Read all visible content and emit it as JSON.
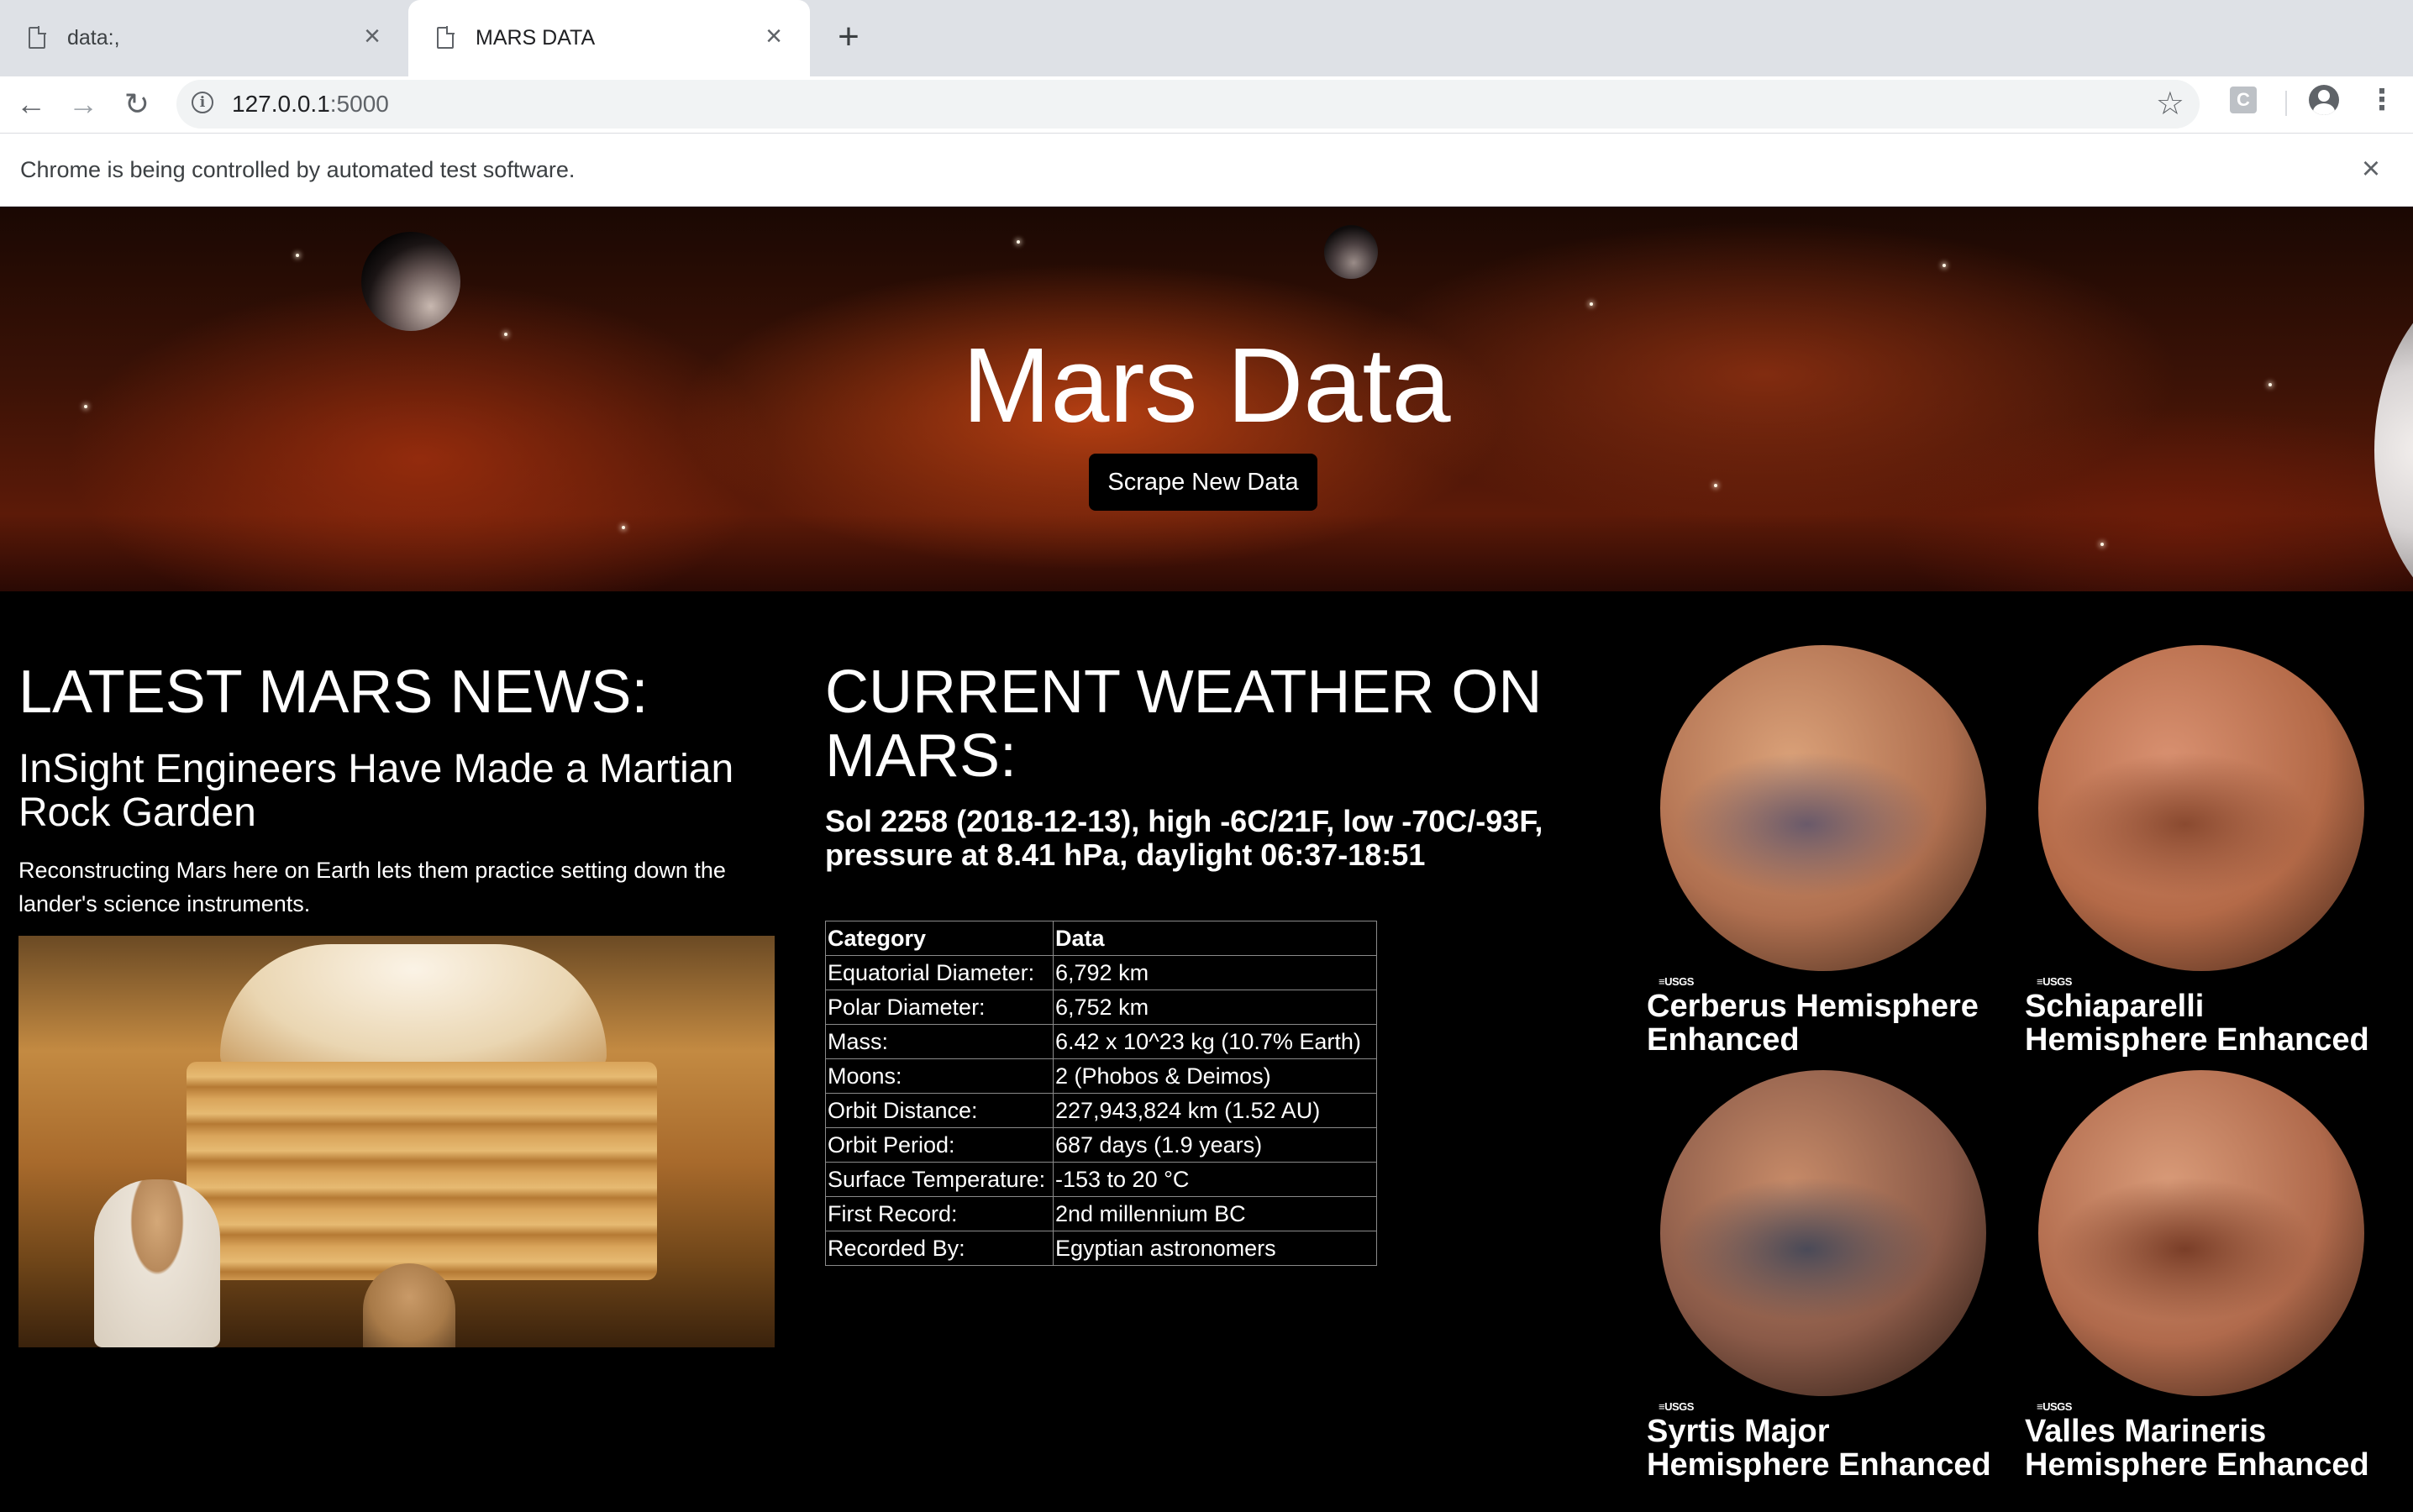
{
  "browser": {
    "tabs": [
      {
        "label": "data:,"
      },
      {
        "label": "MARS DATA"
      }
    ],
    "url_host": "127.0.0.1",
    "url_port": ":5000",
    "infobar_text": "Chrome is being controlled by automated test software.",
    "icons": {
      "back": "back-arrow-icon",
      "forward": "forward-arrow-icon",
      "reload": "reload-icon",
      "site_info": "info-icon",
      "bookmark": "star-icon",
      "extension": "extension-icon",
      "extension_letter": "C",
      "profile": "profile-icon",
      "menu": "kebab-menu-icon"
    }
  },
  "page": {
    "title": "Mars Data",
    "scrape_button": "Scrape New Data",
    "news": {
      "heading": "LATEST MARS NEWS:",
      "title": "InSight Engineers Have Made a Martian Rock Garden",
      "body": "Reconstructing Mars here on Earth lets them practice setting down the lander's science instruments."
    },
    "weather": {
      "heading": "CURRENT WEATHER ON MARS:",
      "text": "Sol 2258 (2018-12-13), high -6C/21F, low -70C/-93F, pressure at 8.41 hPa, daylight 06:37-18:51"
    },
    "facts": {
      "headers": [
        "Category",
        "Data"
      ],
      "rows": [
        [
          "Equatorial Diameter:",
          "6,792 km"
        ],
        [
          "Polar Diameter:",
          "6,752 km"
        ],
        [
          "Mass:",
          "6.42 x 10^23 kg (10.7% Earth)"
        ],
        [
          "Moons:",
          "2 (Phobos & Deimos)"
        ],
        [
          "Orbit Distance:",
          "227,943,824 km (1.52 AU)"
        ],
        [
          "Orbit Period:",
          "687 days (1.9 years)"
        ],
        [
          "Surface Temperature:",
          "-153 to 20 °C"
        ],
        [
          "First Record:",
          "2nd millennium BC"
        ],
        [
          "Recorded By:",
          "Egyptian astronomers"
        ]
      ]
    },
    "hemispheres": [
      {
        "title": "Cerberus Hemisphere Enhanced",
        "logo": "≡USGS",
        "colors": [
          "#d9a078",
          "#b07050",
          "#6a5a6a",
          "#3a2418"
        ]
      },
      {
        "title": "Schiaparelli Hemisphere Enhanced",
        "logo": "≡USGS",
        "colors": [
          "#d89070",
          "#b46a48",
          "#8a4a30",
          "#3a2014"
        ]
      },
      {
        "title": "Syrtis Major Hemisphere Enhanced",
        "logo": "≡USGS",
        "colors": [
          "#c68a68",
          "#8a5a48",
          "#4a4a58",
          "#20140e"
        ]
      },
      {
        "title": "Valles Marineris Hemisphere Enhanced",
        "logo": "≡USGS",
        "colors": [
          "#d89a78",
          "#b06a4c",
          "#7a3e28",
          "#301a10"
        ]
      }
    ],
    "colors": {
      "background": "#000000",
      "text": "#ffffff",
      "button_bg": "#000000"
    }
  }
}
